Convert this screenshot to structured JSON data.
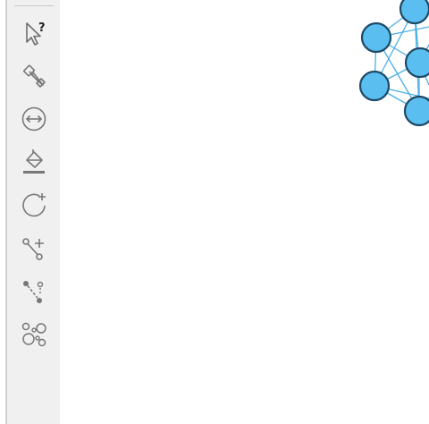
{
  "toolbar": {
    "tools": [
      {
        "name": "help-select-tool",
        "icon": "cursor-question-icon"
      },
      {
        "name": "paint-nodes-tool",
        "icon": "paintbrush-icon"
      },
      {
        "name": "resize-tool",
        "icon": "circle-double-arrow-icon"
      },
      {
        "name": "fill-color-tool",
        "icon": "paint-bucket-icon"
      },
      {
        "name": "add-circle-tool",
        "icon": "circle-plus-icon"
      },
      {
        "name": "add-edge-tool",
        "icon": "edge-plus-icon"
      },
      {
        "name": "add-edge-dashed-tool",
        "icon": "edge-dashed-icon"
      },
      {
        "name": "node-cluster-tool",
        "icon": "node-cluster-icon"
      }
    ]
  },
  "graph": {
    "node_color": "#5bbef0",
    "node_stroke": "#1e4a66",
    "edge_color": "#4ab0e8",
    "node_count": 6
  }
}
